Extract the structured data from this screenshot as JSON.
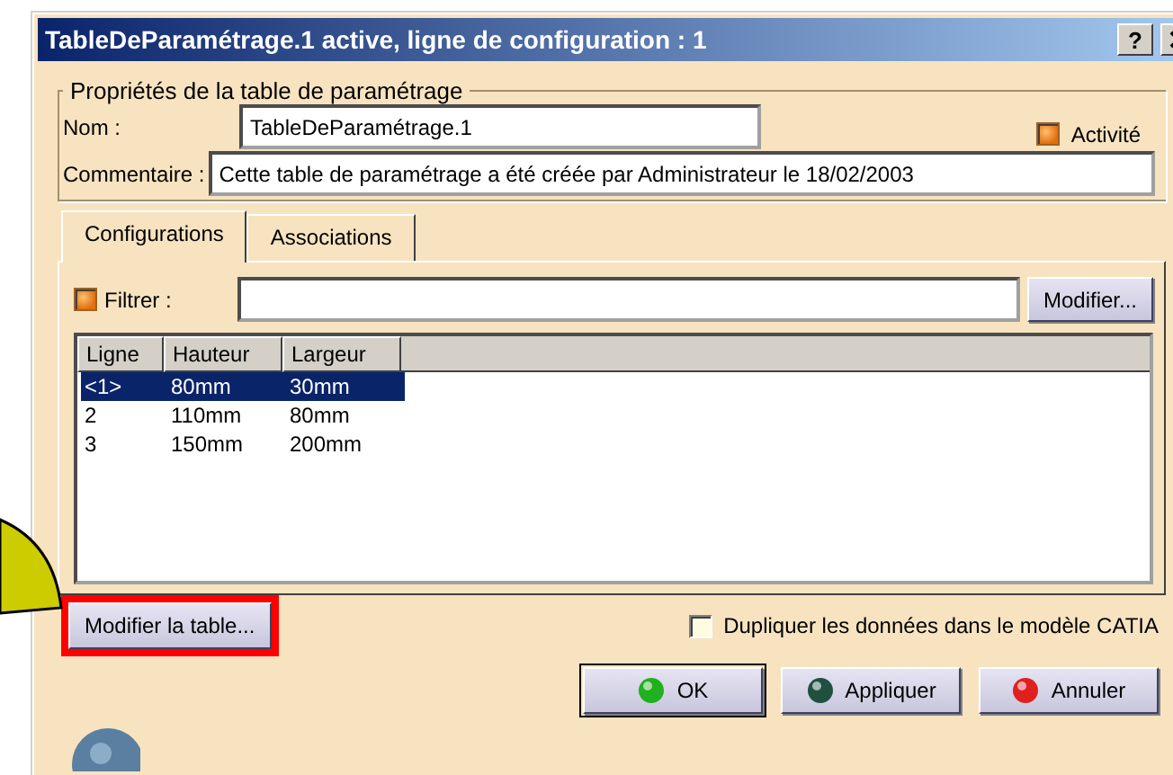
{
  "window": {
    "title": "TableDeParamétrage.1 active, ligne de configuration : 1",
    "help_button": "?"
  },
  "properties": {
    "legend": "Propriétés de la table de paramétrage",
    "name_label": "Nom :",
    "name_value": "TableDeParamétrage.1",
    "activity": {
      "label": "Activité",
      "checked": true
    },
    "comment_label": "Commentaire :",
    "comment_value": "Cette table de paramétrage a été créée par Administrateur le 18/02/2003"
  },
  "tabs": [
    {
      "label": "Configurations",
      "selected": true
    },
    {
      "label": "Associations",
      "selected": false
    }
  ],
  "filter": {
    "label": "Filtrer :",
    "checked": true,
    "button": "Modifier..."
  },
  "table": {
    "columns": [
      "Ligne",
      "Hauteur",
      "Largeur"
    ],
    "rows": [
      {
        "cells": [
          "<1>",
          "80mm",
          "30mm"
        ],
        "selected": true
      },
      {
        "cells": [
          "2",
          "110mm",
          "80mm"
        ],
        "selected": false
      },
      {
        "cells": [
          "3",
          "150mm",
          "200mm"
        ],
        "selected": false
      }
    ]
  },
  "edit_table_button": {
    "label": "Modifier la table...",
    "highlighted": true
  },
  "duplicate": {
    "label": "Dupliquer les données dans le modèle CATIA",
    "checked": false
  },
  "buttons": [
    {
      "label": "OK",
      "kind": "ok"
    },
    {
      "label": "Appliquer",
      "kind": "apply"
    },
    {
      "label": "Annuler",
      "kind": "cancel"
    }
  ]
}
